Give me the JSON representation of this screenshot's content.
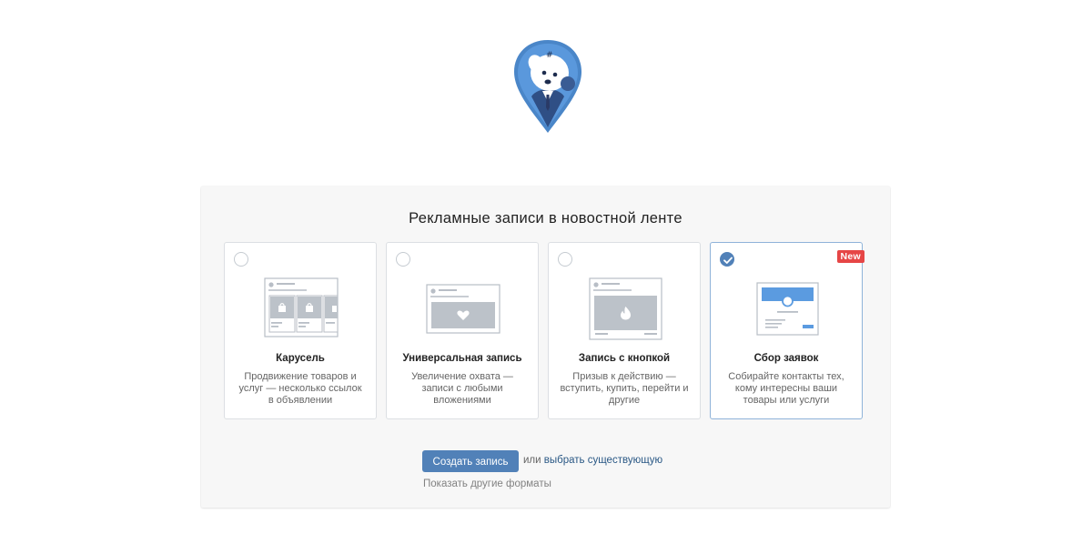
{
  "panel": {
    "title": "Рекламные записи в новостной ленте"
  },
  "cards": [
    {
      "title": "Карусель",
      "description": "Продвижение товаров и услуг — несколько ссылок в объявлении",
      "selected": false,
      "icon": "carousel-illustration"
    },
    {
      "title": "Универсальная запись",
      "description": "Увеличение охвата — записи с любыми вложениями",
      "selected": false,
      "icon": "universal-post-illustration"
    },
    {
      "title": "Запись с кнопкой",
      "description": "Призыв к действию — вступить, купить, перейти и другие",
      "selected": false,
      "icon": "button-post-illustration"
    },
    {
      "title": "Сбор заявок",
      "description": "Собирайте контакты тех, кому интересны ваши товары или услуги",
      "selected": true,
      "badge": "New",
      "icon": "lead-form-illustration"
    }
  ],
  "actions": {
    "create_label": "Создать запись",
    "or_text": "или",
    "choose_existing_label": "выбрать существующую",
    "other_formats_label": "Показать другие форматы"
  },
  "colors": {
    "accent": "#5181b8",
    "link": "#2a5885",
    "badge": "#e64646",
    "panel_bg": "#f7f7f7",
    "illustration_accent": "#5b9be0"
  }
}
